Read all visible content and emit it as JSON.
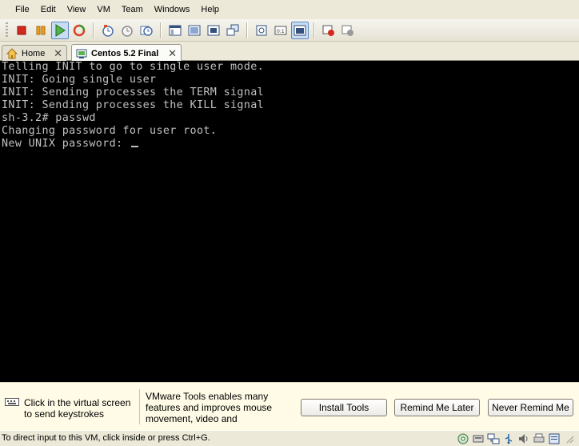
{
  "menu": [
    "File",
    "Edit",
    "View",
    "VM",
    "Team",
    "Windows",
    "Help"
  ],
  "toolbar": {
    "buttons": [
      "stop-icon",
      "pause-icon",
      "play-icon",
      "reset-icon",
      "snapshot-icon",
      "revert-snapshot-icon",
      "snapshot-manager-icon",
      "normal-view-icon",
      "full-screen-icon",
      "quick-switch-icon",
      "summary-view-icon",
      "console-view-icon",
      "appliance-view-icon",
      "vm-console-icon",
      "record-icon",
      "replay-icon"
    ]
  },
  "tabs": {
    "home_label": "Home",
    "vm_label": "Centos 5.2 Final",
    "close_glyph": "✕"
  },
  "console": {
    "lines": [
      "Telling INIT to go to single user mode.",
      "INIT: Going single user",
      "INIT: Sending processes the TERM signal",
      "INIT: Sending processes the KILL signal",
      "sh-3.2# passwd",
      "Changing password for user root.",
      "New UNIX password: "
    ]
  },
  "hint": {
    "click_text": "Click in the virtual screen to send keystrokes",
    "tools_text": "VMware Tools enables many features and improves mouse movement, video and",
    "install_label": "Install Tools",
    "remind_label": "Remind Me Later",
    "never_label": "Never Remind Me"
  },
  "status": {
    "text": "To direct input to this VM, click inside or press Ctrl+G."
  },
  "colors": {
    "console_bg": "#000000",
    "console_fg": "#c0c0c0",
    "hint_bg": "#fffbe6",
    "chrome_bg": "#ece9d8"
  }
}
